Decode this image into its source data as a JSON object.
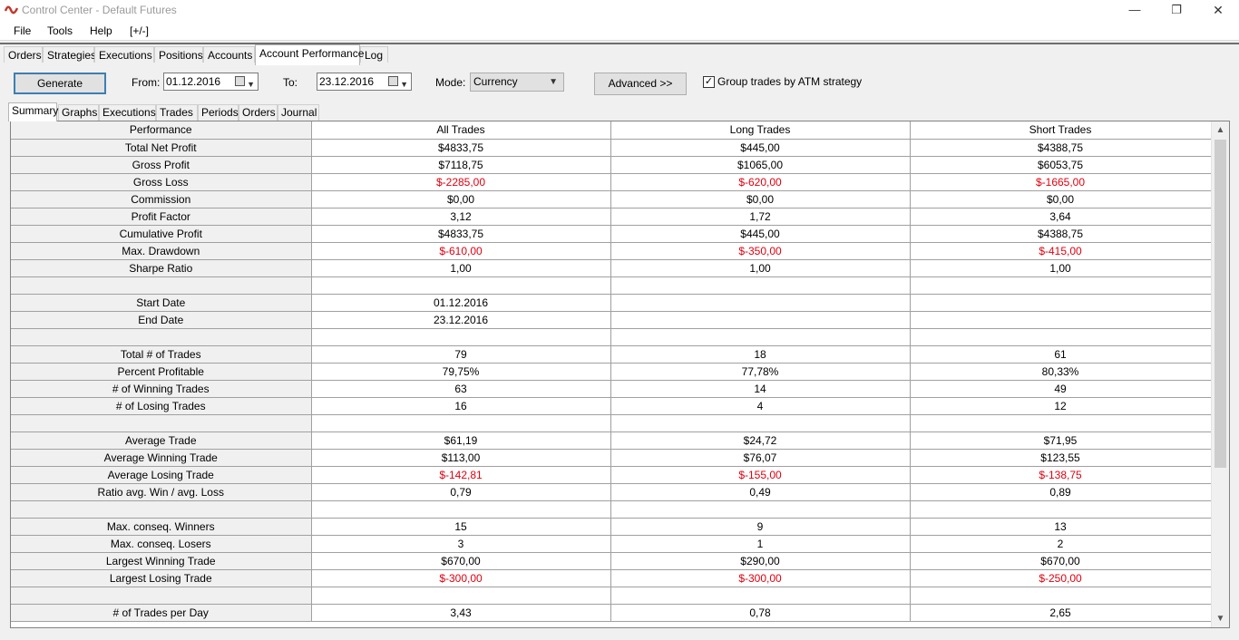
{
  "window": {
    "title": "Control Center - Default Futures",
    "minimize": "—",
    "maximize": "❐",
    "close": "✕",
    "icon": "ninja-logo-icon",
    "accent_color": "#c0392b"
  },
  "menu": [
    "File",
    "Tools",
    "Help",
    "[+/-]"
  ],
  "main_tabs": [
    "Orders",
    "Strategies",
    "Executions",
    "Positions",
    "Accounts",
    "Account Performance",
    "Log"
  ],
  "toolbar": {
    "generate_label": "Generate",
    "from_label": "From:",
    "from_value": "01.12.2016",
    "to_label": "To:",
    "to_value": "23.12.2016",
    "mode_label": "Mode:",
    "mode_value": "Currency",
    "advanced_label": "Advanced >>",
    "group_checkbox_checked": true,
    "group_checkbox_mark": "✓",
    "group_label": "Group trades by ATM strategy"
  },
  "sub_tabs": [
    "Summary",
    "Graphs",
    "Executions",
    "Trades",
    "Periods",
    "Orders",
    "Journal"
  ],
  "table": {
    "headers": [
      "Performance",
      "All Trades",
      "Long Trades",
      "Short Trades"
    ],
    "negative_color": "#e0000f",
    "rows": [
      {
        "label": "Total Net Profit",
        "all": "$4833,75",
        "long": "$445,00",
        "short": "$4388,75",
        "neg": false
      },
      {
        "label": "Gross Profit",
        "all": "$7118,75",
        "long": "$1065,00",
        "short": "$6053,75",
        "neg": false
      },
      {
        "label": "Gross Loss",
        "all": "$-2285,00",
        "long": "$-620,00",
        "short": "$-1665,00",
        "neg": true
      },
      {
        "label": "Commission",
        "all": "$0,00",
        "long": "$0,00",
        "short": "$0,00",
        "neg": false
      },
      {
        "label": "Profit Factor",
        "all": "3,12",
        "long": "1,72",
        "short": "3,64",
        "neg": false
      },
      {
        "label": "Cumulative Profit",
        "all": "$4833,75",
        "long": "$445,00",
        "short": "$4388,75",
        "neg": false
      },
      {
        "label": "Max. Drawdown",
        "all": "$-610,00",
        "long": "$-350,00",
        "short": "$-415,00",
        "neg": true
      },
      {
        "label": "Sharpe Ratio",
        "all": "1,00",
        "long": "1,00",
        "short": "1,00",
        "neg": false
      },
      {
        "label": "",
        "all": "",
        "long": "",
        "short": "",
        "neg": false
      },
      {
        "label": "Start Date",
        "all": "01.12.2016",
        "long": "",
        "short": "",
        "neg": false
      },
      {
        "label": "End Date",
        "all": "23.12.2016",
        "long": "",
        "short": "",
        "neg": false
      },
      {
        "label": "",
        "all": "",
        "long": "",
        "short": "",
        "neg": false
      },
      {
        "label": "Total # of Trades",
        "all": "79",
        "long": "18",
        "short": "61",
        "neg": false
      },
      {
        "label": "Percent Profitable",
        "all": "79,75%",
        "long": "77,78%",
        "short": "80,33%",
        "neg": false
      },
      {
        "label": "# of Winning Trades",
        "all": "63",
        "long": "14",
        "short": "49",
        "neg": false
      },
      {
        "label": "# of Losing Trades",
        "all": "16",
        "long": "4",
        "short": "12",
        "neg": false
      },
      {
        "label": "",
        "all": "",
        "long": "",
        "short": "",
        "neg": false
      },
      {
        "label": "Average Trade",
        "all": "$61,19",
        "long": "$24,72",
        "short": "$71,95",
        "neg": false
      },
      {
        "label": "Average Winning Trade",
        "all": "$113,00",
        "long": "$76,07",
        "short": "$123,55",
        "neg": false
      },
      {
        "label": "Average Losing Trade",
        "all": "$-142,81",
        "long": "$-155,00",
        "short": "$-138,75",
        "neg": true
      },
      {
        "label": "Ratio avg. Win / avg. Loss",
        "all": "0,79",
        "long": "0,49",
        "short": "0,89",
        "neg": false
      },
      {
        "label": "",
        "all": "",
        "long": "",
        "short": "",
        "neg": false
      },
      {
        "label": "Max. conseq. Winners",
        "all": "15",
        "long": "9",
        "short": "13",
        "neg": false
      },
      {
        "label": "Max. conseq. Losers",
        "all": "3",
        "long": "1",
        "short": "2",
        "neg": false
      },
      {
        "label": "Largest Winning Trade",
        "all": "$670,00",
        "long": "$290,00",
        "short": "$670,00",
        "neg": false
      },
      {
        "label": "Largest Losing Trade",
        "all": "$-300,00",
        "long": "$-300,00",
        "short": "$-250,00",
        "neg": true
      },
      {
        "label": "",
        "all": "",
        "long": "",
        "short": "",
        "neg": false
      },
      {
        "label": "# of Trades per Day",
        "all": "3,43",
        "long": "0,78",
        "short": "2,65",
        "neg": false
      }
    ]
  },
  "scrollbar": {
    "up": "▲",
    "down": "▼"
  }
}
